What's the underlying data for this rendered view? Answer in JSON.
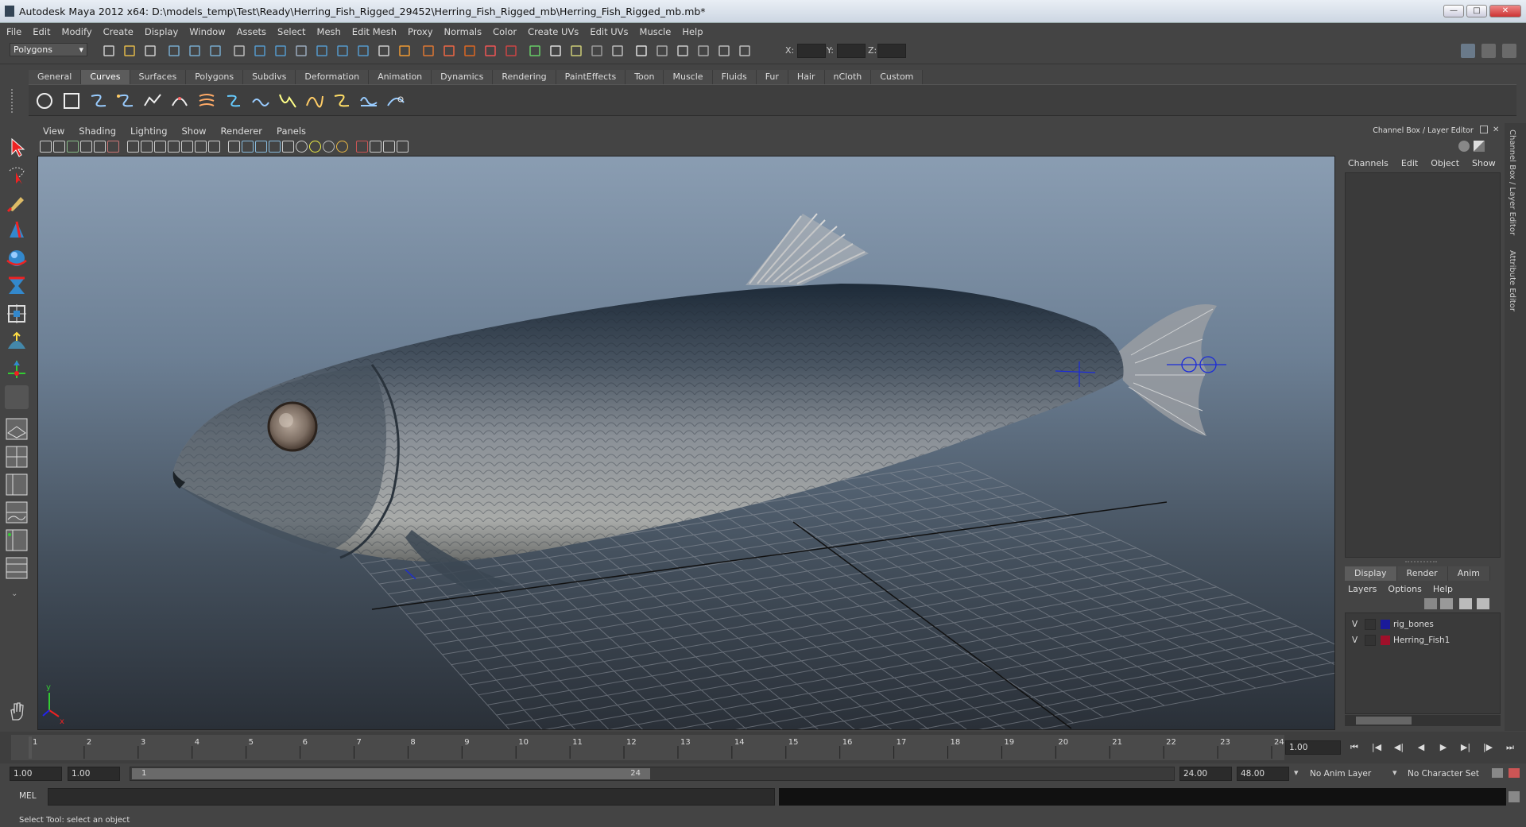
{
  "window": {
    "title": "Autodesk Maya 2012 x64: D:\\models_temp\\Test\\Ready\\Herring_Fish_Rigged_29452\\Herring_Fish_Rigged_mb\\Herring_Fish_Rigged_mb.mb*",
    "controls": [
      "—",
      "□",
      "✕"
    ]
  },
  "menubar": [
    "File",
    "Edit",
    "Modify",
    "Create",
    "Display",
    "Window",
    "Assets",
    "Select",
    "Mesh",
    "Edit Mesh",
    "Proxy",
    "Normals",
    "Color",
    "Create UVs",
    "Edit UVs",
    "Muscle",
    "Help"
  ],
  "statusline": {
    "mode": "Polygons",
    "x_label": "X:",
    "y_label": "Y:",
    "z_label": "Z:"
  },
  "shelf": {
    "tabs": [
      "General",
      "Curves",
      "Surfaces",
      "Polygons",
      "Subdivs",
      "Deformation",
      "Animation",
      "Dynamics",
      "Rendering",
      "PaintEffects",
      "Toon",
      "Muscle",
      "Fluids",
      "Fur",
      "Hair",
      "nCloth",
      "Custom"
    ],
    "active": "Curves"
  },
  "viewport": {
    "menu": [
      "View",
      "Shading",
      "Lighting",
      "Show",
      "Renderer",
      "Panels"
    ],
    "axis_y": "y",
    "axis_x": "x"
  },
  "channelbox": {
    "title": "Channel Box / Layer Editor",
    "menu": [
      "Channels",
      "Edit",
      "Object",
      "Show"
    ]
  },
  "layereditor": {
    "tabs": [
      "Display",
      "Render",
      "Anim"
    ],
    "active": "Display",
    "menu": [
      "Layers",
      "Options",
      "Help"
    ],
    "layers": [
      {
        "v": "V",
        "name": "rig_bones",
        "color": "#1a1a9a"
      },
      {
        "v": "V",
        "name": "Herring_Fish1",
        "color": "#a0102a"
      }
    ]
  },
  "sidetabs": [
    "Channel Box / Layer Editor",
    "Attribute Editor"
  ],
  "timeslider": {
    "ticks": [
      "1",
      "2",
      "3",
      "4",
      "5",
      "6",
      "7",
      "8",
      "9",
      "10",
      "11",
      "12",
      "13",
      "14",
      "15",
      "16",
      "17",
      "18",
      "19",
      "20",
      "21",
      "22",
      "23",
      "24"
    ],
    "current_time": "1.00",
    "playback_buttons": [
      "⏮",
      "|◀",
      "◀|",
      "◀",
      "▶",
      "▶|",
      "|▶",
      "⏭"
    ]
  },
  "rangeslider": {
    "start": "1.00",
    "playback_start": "1.00",
    "range_start_label": "1",
    "range_end_label": "24",
    "playback_end": "24.00",
    "end": "48.00",
    "anim_layer": "No Anim Layer",
    "character_set": "No Character Set"
  },
  "cmdline": {
    "label": "MEL"
  },
  "helpline": "Select Tool: select an object",
  "colors": {
    "maya_bg": "#444444",
    "active_tab": "#5c5c5c",
    "viewport_top": "#8a9db2",
    "viewport_bottom": "#2a3038"
  }
}
